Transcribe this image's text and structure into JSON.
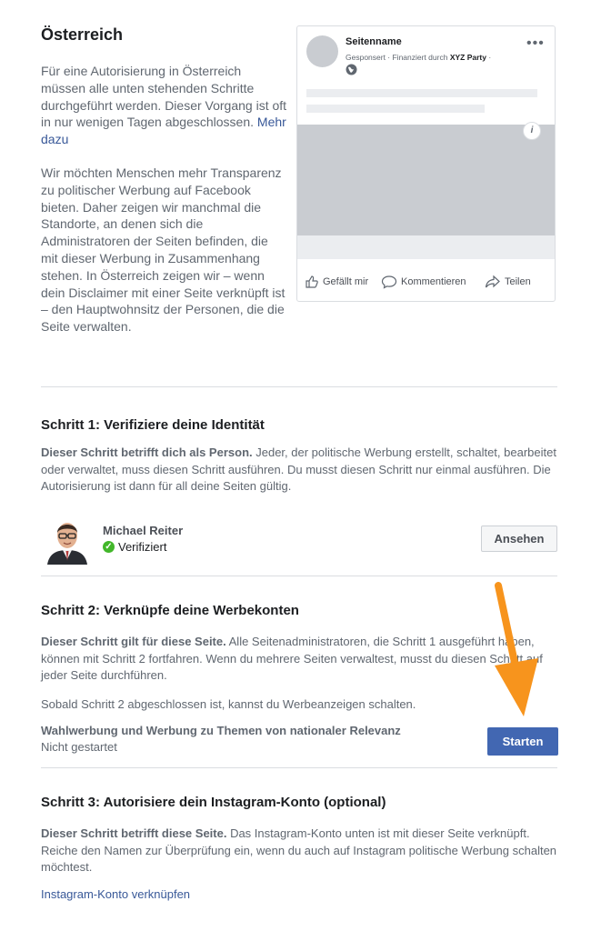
{
  "header": {
    "title": "Österreich",
    "intro_1": "Für eine Autorisierung in Österreich müssen alle unten stehenden Schritte durchgeführt werden. Dieser Vorgang ist oft in nur wenigen Tagen abgeschlossen.",
    "intro_1_link": "Mehr dazu",
    "intro_2": "Wir möchten Menschen mehr Transparenz zu politischer Werbung auf Facebook bieten. Daher zeigen wir manchmal die Standorte, an denen sich die Administratoren der Seiten befinden, die mit dieser Werbung in Zusammenhang stehen. In Österreich zeigen wir – wenn dein Disclaimer mit einer Seite verknüpft ist – den Hauptwohnsitz der Personen, die die Seite verwalten."
  },
  "preview": {
    "page_name": "Seitenname",
    "sponsored_prefix": "Gesponsert · Finanziert durch ",
    "sponsor": "XYZ Party",
    "sponsored_suffix": " ·",
    "more": "•••",
    "info": "i",
    "like": "Gefällt mir",
    "comment": "Kommentieren",
    "share": "Teilen"
  },
  "step1": {
    "heading": "Schritt 1: Verifiziere deine Identität",
    "lead": "Dieser Schritt betrifft dich als Person.",
    "text": " Jeder, der politische Werbung erstellt, schaltet, bearbeitet oder verwaltet, muss diesen Schritt ausführen. Du musst diesen Schritt nur einmal ausführen. Die Autorisierung ist dann für all deine Seiten gültig.",
    "user_name": "Michael Reiter",
    "status": "Verifiziert",
    "view_button": "Ansehen"
  },
  "step2": {
    "heading": "Schritt 2: Verknüpfe deine Werbekonten",
    "lead": "Dieser Schritt gilt für diese Seite.",
    "text": " Alle Seitenadministratoren, die Schritt 1 ausgeführt haben, können mit Schritt 2 fortfahren. Wenn du mehrere Seiten verwaltest, musst du diesen Schritt auf jeder Seite durchführen.",
    "note": "Sobald Schritt 2 abgeschlossen ist, kannst du Werbeanzeigen schalten.",
    "row_title": "Wahlwerbung und Werbung zu Themen von nationaler Relevanz",
    "row_status": "Nicht gestartet",
    "start_button": "Starten"
  },
  "step3": {
    "heading": "Schritt 3: Autorisiere dein Instagram-Konto (optional)",
    "lead": "Dieser Schritt betrifft diese Seite.",
    "text": " Das Instagram-Konto unten ist mit dieser Seite verknüpft. Reiche den Namen zur Überprüfung ein, wenn du auch auf Instagram politische Werbung schalten möchtest.",
    "link": "Instagram-Konto verknüpfen"
  },
  "colors": {
    "primary": "#4267b2",
    "link": "#385898",
    "verified": "#42b72a",
    "arrow": "#f7941d"
  }
}
